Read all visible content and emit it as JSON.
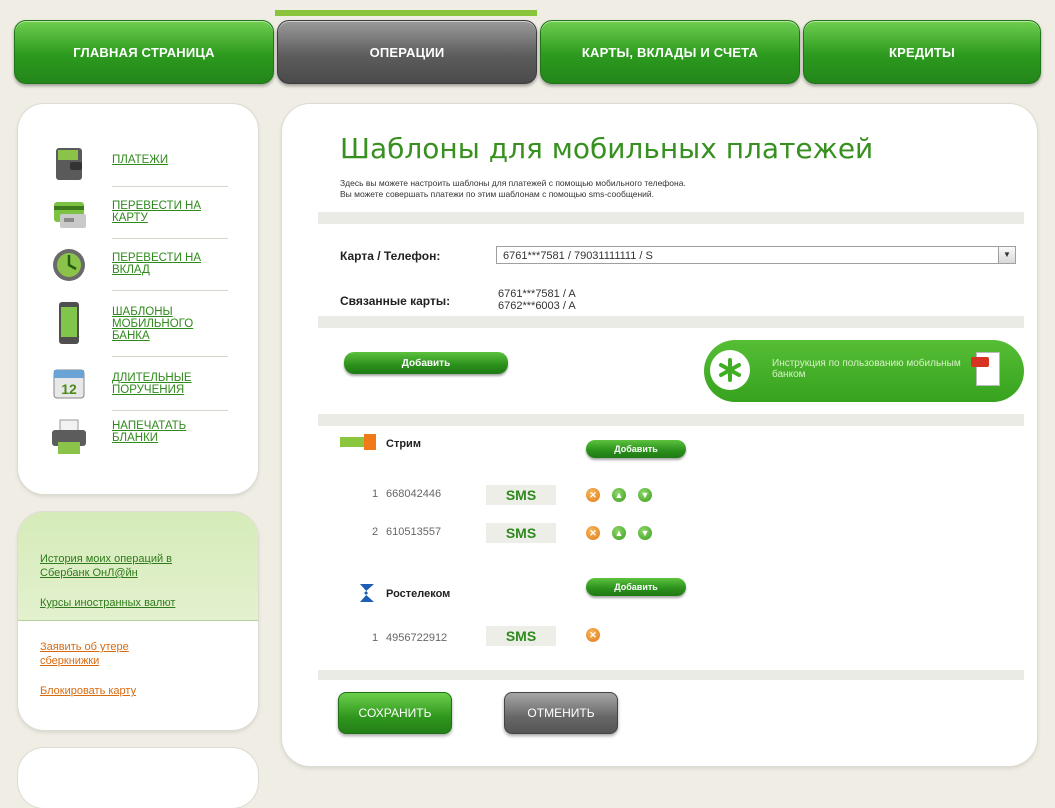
{
  "nav": {
    "tabs": [
      {
        "label": "ГЛАВНАЯ СТРАНИЦА"
      },
      {
        "label": "ОПЕРАЦИИ"
      },
      {
        "label": "КАРТЫ, ВКЛАДЫ И СЧЕТА"
      },
      {
        "label": "КРЕДИТЫ"
      }
    ]
  },
  "sidebar": {
    "items": [
      {
        "label": "ПЛАТЕЖИ",
        "icon": "wallet-icon"
      },
      {
        "label": "ПЕРЕВЕСТИ НА КАРТУ",
        "icon": "card-transfer-icon"
      },
      {
        "label": "ПЕРЕВЕСТИ НА ВКЛАД",
        "icon": "clock-deposit-icon"
      },
      {
        "label": "ШАБЛОНЫ МОБИЛЬНОГО БАНКА",
        "icon": "mobile-phone-icon"
      },
      {
        "label": "ДЛИТЕЛЬНЫЕ ПОРУЧЕНИЯ",
        "icon": "calendar-icon"
      },
      {
        "label": "НАПЕЧАТАТЬ БЛАНКИ",
        "icon": "printer-icon"
      }
    ],
    "links": {
      "history": "История моих операций в Сбербанк ОнЛ@йн",
      "rates": "Курсы иностранных валют",
      "complaint": "Заявить об утере сберкнижки",
      "block": "Блокировать карту"
    }
  },
  "main": {
    "title": "Шаблоны для мобильных платежей",
    "desc_line1": "Здесь вы можете настроить шаблоны для платежей с помощью мобильного телефона.",
    "desc_line2": "Вы можете совершать платежи по этим шаблонам с помощью sms-сообщений.",
    "card_phone_label": "Карта / Телефон:",
    "card_phone_value": "6761***7581 / 79031111111 / S",
    "linked_label": "Связанные карты:",
    "linked_1": "6761***7581 / A",
    "linked_2": "6762***6003 / A",
    "add_label": "Добавить",
    "instruction_text": "Инструкция по пользованию мобильным банком",
    "operators": [
      {
        "name": "Стрим",
        "add_label": "Добавить",
        "rows": [
          {
            "index": "1",
            "number": "668042446",
            "tag": "SMS"
          },
          {
            "index": "2",
            "number": "610513557",
            "tag": "SMS"
          }
        ]
      },
      {
        "name": "Ростелеком",
        "add_label": "Добавить",
        "rows": [
          {
            "index": "1",
            "number": "4956722912",
            "tag": "SMS"
          }
        ]
      }
    ],
    "save_label": "СОХРАНИТЬ",
    "cancel_label": "ОТМЕНИТЬ"
  },
  "colors": {
    "accent_green": "#37901f",
    "tab_green": "#2c9a1e",
    "tab_gray": "#5d5d5d",
    "link_orange": "#d86a10"
  }
}
